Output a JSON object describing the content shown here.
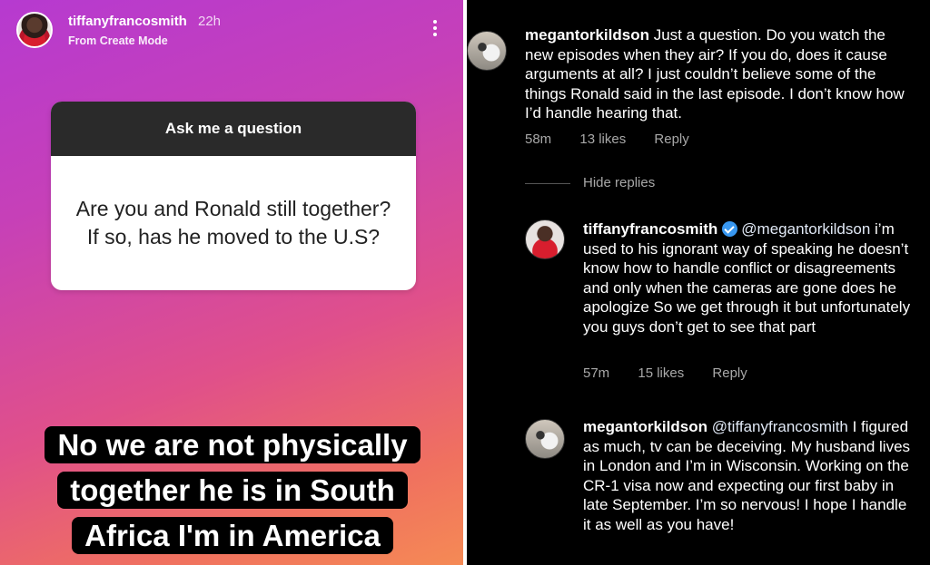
{
  "story": {
    "username": "tiffanyfrancosmith",
    "time": "22h",
    "subtitle": "From Create Mode",
    "question_card": {
      "header": "Ask me a question",
      "question": "Are you and Ronald still together? If so, has he moved to the U.S?"
    },
    "answer": "No we are not physically together he is in South Africa I'm in America"
  },
  "comments": [
    {
      "username": "megantorkildson",
      "mention": "",
      "text": "Just a question. Do you watch the new episodes when they air? If you do, does it cause arguments at all? I just couldn’t believe some of the things Ronald said in the last episode. I don’t know how I’d handle hearing that.",
      "time": "58m",
      "likes": "13 likes",
      "reply": "Reply"
    },
    {
      "username": "tiffanyfrancosmith",
      "verified": true,
      "mention": "@megantorkildson",
      "text": "i’m used to his ignorant way of speaking he doesn’t know how to handle conflict or disagreements and only when the cameras are gone does he apologize So we get through it but unfortunately you guys don’t get to see that part",
      "time": "57m",
      "likes": "15 likes",
      "reply": "Reply"
    },
    {
      "username": "megantorkildson",
      "mention": "@tiffanyfrancosmith",
      "text": "I figured as much, tv can be deceiving. My husband lives in London and I’m in Wisconsin. Working on the CR-1 visa now and expecting our first baby in late September. I’m so nervous! I hope I handle it as well as you have!"
    }
  ],
  "hide_replies": "Hide replies",
  "colors": {
    "story_gradient_start": "#b63ad0",
    "story_gradient_end": "#f58a55",
    "verified_badge": "#3897f0",
    "meta_text": "#a8a8a8"
  },
  "icons": {
    "more": "more-vertical-icon",
    "verified": "verified-badge-icon"
  }
}
